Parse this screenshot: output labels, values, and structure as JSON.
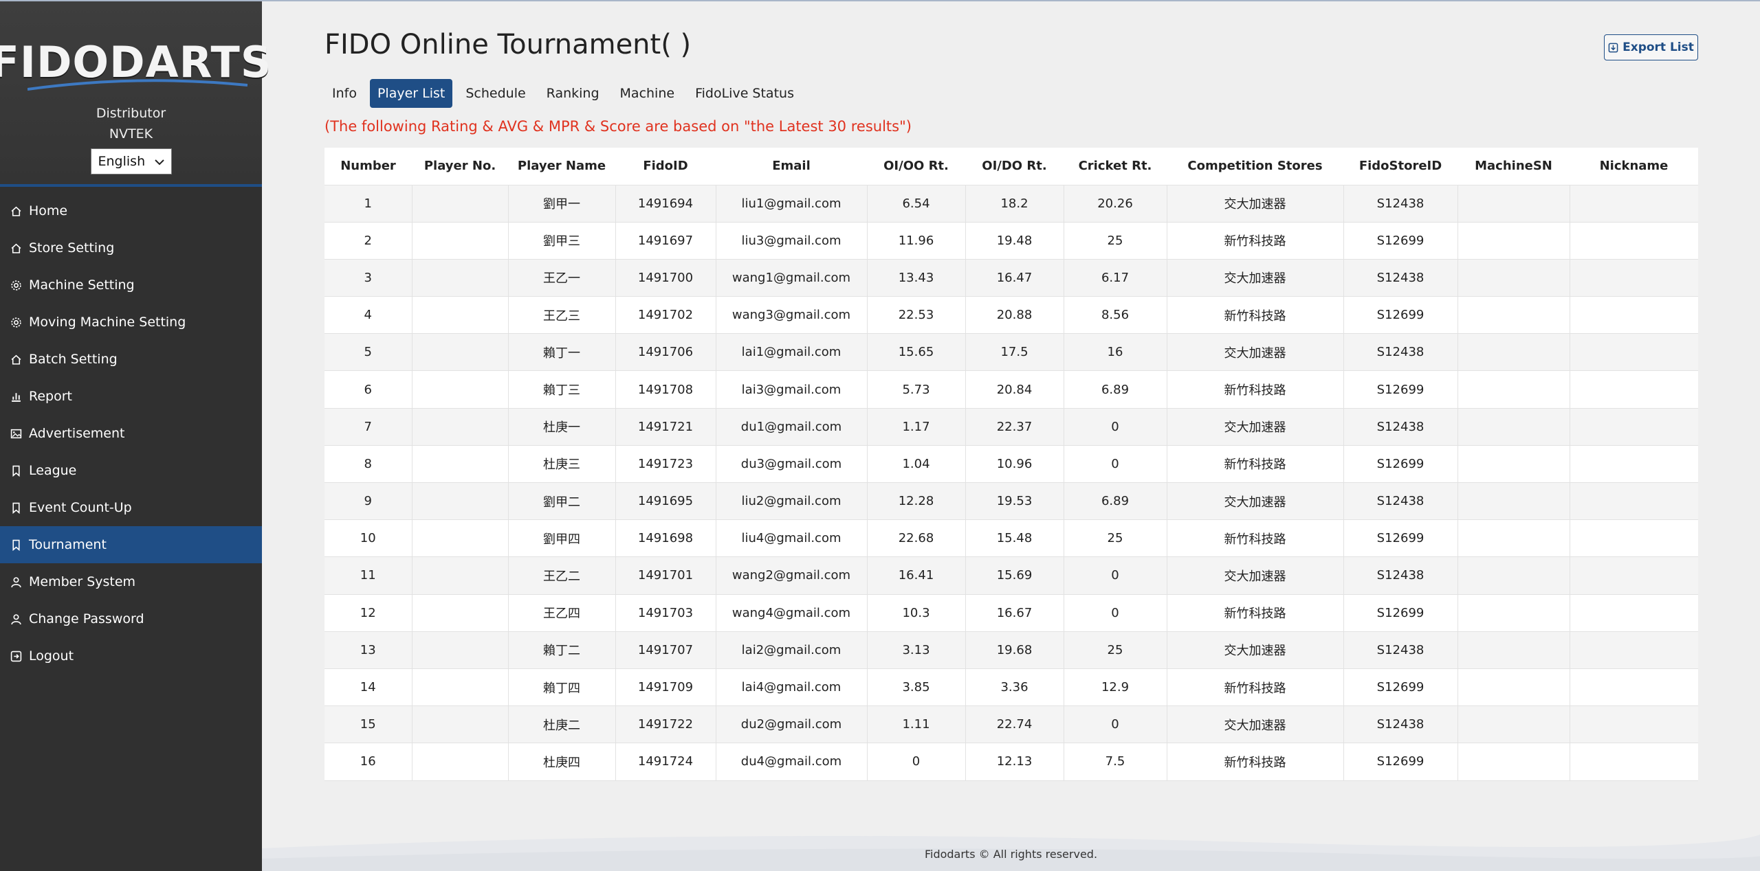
{
  "sidebar": {
    "brand": "FIDODARTS",
    "distributor_label": "Distributor",
    "distributor_name": "NVTEK",
    "language": "English",
    "items": [
      {
        "label": "Home",
        "icon": "home-icon"
      },
      {
        "label": "Store Setting",
        "icon": "home-icon"
      },
      {
        "label": "Machine Setting",
        "icon": "gear-icon"
      },
      {
        "label": "Moving Machine Setting",
        "icon": "gear-icon"
      },
      {
        "label": "Batch Setting",
        "icon": "home-icon"
      },
      {
        "label": "Report",
        "icon": "bar-chart-icon"
      },
      {
        "label": "Advertisement",
        "icon": "image-icon"
      },
      {
        "label": "League",
        "icon": "bookmark-icon"
      },
      {
        "label": "Event Count-Up",
        "icon": "bookmark-icon"
      },
      {
        "label": "Tournament",
        "icon": "bookmark-icon",
        "active": true
      },
      {
        "label": "Member System",
        "icon": "user-icon"
      },
      {
        "label": "Change Password",
        "icon": "user-icon"
      },
      {
        "label": "Logout",
        "icon": "logout-icon"
      }
    ]
  },
  "header": {
    "title": "FIDO Online Tournament( )",
    "export_label": "Export List"
  },
  "tabs": [
    "Info",
    "Player List",
    "Schedule",
    "Ranking",
    "Machine",
    "FidoLive Status"
  ],
  "active_tab": "Player List",
  "notice": "(The following Rating & AVG & MPR & Score are based on \"the Latest 30 results\")",
  "table": {
    "columns": [
      "Number",
      "Player No.",
      "Player Name",
      "FidoID",
      "Email",
      "OI/OO Rt.",
      "OI/DO Rt.",
      "Cricket Rt.",
      "Competition Stores",
      "FidoStoreID",
      "MachineSN",
      "Nickname"
    ],
    "rows": [
      [
        "1",
        "",
        "劉甲一",
        "1491694",
        "liu1@gmail.com",
        "6.54",
        "18.2",
        "20.26",
        "交大加速器",
        "S12438",
        "",
        ""
      ],
      [
        "2",
        "",
        "劉甲三",
        "1491697",
        "liu3@gmail.com",
        "11.96",
        "19.48",
        "25",
        "新竹科技路",
        "S12699",
        "",
        ""
      ],
      [
        "3",
        "",
        "王乙一",
        "1491700",
        "wang1@gmail.com",
        "13.43",
        "16.47",
        "6.17",
        "交大加速器",
        "S12438",
        "",
        ""
      ],
      [
        "4",
        "",
        "王乙三",
        "1491702",
        "wang3@gmail.com",
        "22.53",
        "20.88",
        "8.56",
        "新竹科技路",
        "S12699",
        "",
        ""
      ],
      [
        "5",
        "",
        "賴丁一",
        "1491706",
        "lai1@gmail.com",
        "15.65",
        "17.5",
        "16",
        "交大加速器",
        "S12438",
        "",
        ""
      ],
      [
        "6",
        "",
        "賴丁三",
        "1491708",
        "lai3@gmail.com",
        "5.73",
        "20.84",
        "6.89",
        "新竹科技路",
        "S12699",
        "",
        ""
      ],
      [
        "7",
        "",
        "杜庚一",
        "1491721",
        "du1@gmail.com",
        "1.17",
        "22.37",
        "0",
        "交大加速器",
        "S12438",
        "",
        ""
      ],
      [
        "8",
        "",
        "杜庚三",
        "1491723",
        "du3@gmail.com",
        "1.04",
        "10.96",
        "0",
        "新竹科技路",
        "S12699",
        "",
        ""
      ],
      [
        "9",
        "",
        "劉甲二",
        "1491695",
        "liu2@gmail.com",
        "12.28",
        "19.53",
        "6.89",
        "交大加速器",
        "S12438",
        "",
        ""
      ],
      [
        "10",
        "",
        "劉甲四",
        "1491698",
        "liu4@gmail.com",
        "22.68",
        "15.48",
        "25",
        "新竹科技路",
        "S12699",
        "",
        ""
      ],
      [
        "11",
        "",
        "王乙二",
        "1491701",
        "wang2@gmail.com",
        "16.41",
        "15.69",
        "0",
        "交大加速器",
        "S12438",
        "",
        ""
      ],
      [
        "12",
        "",
        "王乙四",
        "1491703",
        "wang4@gmail.com",
        "10.3",
        "16.67",
        "0",
        "新竹科技路",
        "S12699",
        "",
        ""
      ],
      [
        "13",
        "",
        "賴丁二",
        "1491707",
        "lai2@gmail.com",
        "3.13",
        "19.68",
        "25",
        "交大加速器",
        "S12438",
        "",
        ""
      ],
      [
        "14",
        "",
        "賴丁四",
        "1491709",
        "lai4@gmail.com",
        "3.85",
        "3.36",
        "12.9",
        "新竹科技路",
        "S12699",
        "",
        ""
      ],
      [
        "15",
        "",
        "杜庚二",
        "1491722",
        "du2@gmail.com",
        "1.11",
        "22.74",
        "0",
        "交大加速器",
        "S12438",
        "",
        ""
      ],
      [
        "16",
        "",
        "杜庚四",
        "1491724",
        "du4@gmail.com",
        "0",
        "12.13",
        "7.5",
        "新竹科技路",
        "S12699",
        "",
        ""
      ]
    ]
  },
  "footer": "Fidodarts © All rights reserved.",
  "colors": {
    "accent": "#1f4e86",
    "sidebar_bg": "#303030",
    "notice": "#e0321f",
    "page_bg": "#efefef"
  }
}
